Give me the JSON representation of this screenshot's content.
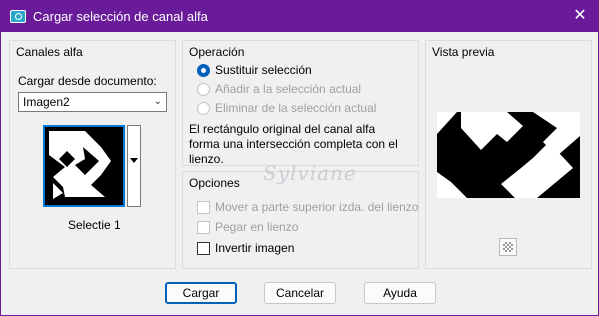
{
  "window": {
    "title": "Cargar selección de canal alfa",
    "close_symbol": "✕"
  },
  "channels": {
    "group_title": "Canales alfa",
    "load_from_label": "Cargar desde documento:",
    "document_value": "Imagen2",
    "selection_name": "Selectie 1"
  },
  "operation": {
    "group_title": "Operación",
    "options": [
      {
        "label": "Sustituir selección",
        "checked": true,
        "enabled": true
      },
      {
        "label": "Añadir a la selección actual",
        "checked": false,
        "enabled": false
      },
      {
        "label": "Eliminar de la selección actual",
        "checked": false,
        "enabled": false
      }
    ],
    "description": "El rectángulo original del canal alfa forma una intersección completa con el lienzo."
  },
  "options": {
    "group_title": "Opciones",
    "checkboxes": [
      {
        "label": "Mover a parte superior izda. del lienzo",
        "checked": false,
        "enabled": false
      },
      {
        "label": "Pegar en lienzo",
        "checked": false,
        "enabled": false
      },
      {
        "label": "Invertir imagen",
        "checked": false,
        "enabled": true
      }
    ]
  },
  "preview": {
    "group_title": "Vista previa"
  },
  "buttons": {
    "load": "Cargar",
    "cancel": "Cancelar",
    "help": "Ayuda"
  },
  "watermark": "Sylviane"
}
